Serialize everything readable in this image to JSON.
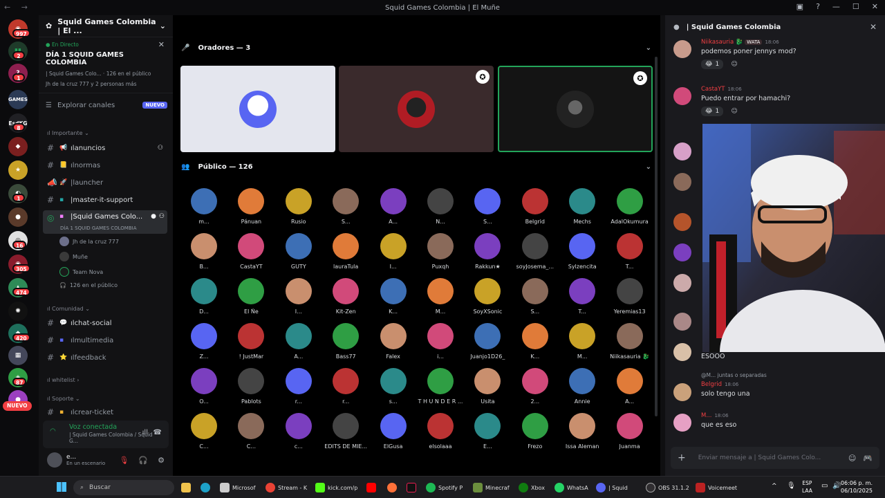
{
  "window": {
    "title": "Squid Games Colombia | El Muñe",
    "nav": "← →"
  },
  "servers": {
    "badges": [
      "997",
      "2",
      "1",
      "8",
      "1",
      "16",
      "305",
      "474",
      "420",
      "87"
    ],
    "nuevo": "NUEVO",
    "labels": [
      "GAMES",
      "EsdKG"
    ]
  },
  "sidebar": {
    "server_name": "Squid Games Colombia | El ...",
    "live": {
      "tag": "En Directo",
      "title": "DÍA 1 SQUID GAMES COLOMBIA",
      "subtitle": "| Squid Games Colo... · 126 en el público",
      "people": "Jh de la cruz 777 y 2 personas más"
    },
    "explore": "Explorar canales",
    "explore_badge": "NUEVO",
    "categories": [
      "Importante",
      "Comunidad",
      "whitelist",
      "Soporte"
    ],
    "channels": [
      {
        "name": "anuncios",
        "emoji": "📢"
      },
      {
        "name": "normas",
        "emoji": "📒"
      },
      {
        "name": "launcher",
        "emoji": "🚀"
      },
      {
        "name": "master-it-support",
        "emoji": "▪"
      },
      {
        "name": "Squid Games Colo...",
        "emoji": "▪",
        "sub": "DÍA 1 SQUID GAMES COLOMBIA"
      },
      {
        "name": "chat-social",
        "emoji": "💬"
      },
      {
        "name": "multimedia",
        "emoji": "▪"
      },
      {
        "name": "feedback",
        "emoji": "⭐"
      },
      {
        "name": "crear-ticket",
        "emoji": "▪"
      }
    ],
    "voice_members": [
      "Jh de la cruz 777",
      "Muñe",
      "Team Nova",
      "126 en el público"
    ],
    "voice_panel": {
      "title": "Voz conectada",
      "subtitle": "| Squid Games Colombia / Squid G..."
    },
    "user": {
      "name": "e...",
      "status": "En un escenario"
    }
  },
  "stage": {
    "speakers_header": "Oradores — 3",
    "audience_header": "Público — 126",
    "audience": [
      "m...",
      "Pánuan",
      "Rusio",
      "S...",
      "A...",
      "N...",
      "S...",
      "Belgrid",
      "Mechs",
      "AdalOkumura",
      "B...",
      "CastaYT",
      "GUTY",
      "lauraTula",
      "I...",
      "Puxqh",
      "Rakkun★",
      "soyJosema_...",
      "Sylzencita",
      "T...",
      "D...",
      "El Ñe",
      "I...",
      "Kit-Zen",
      "K...",
      "M...",
      "SoyXSonic",
      "S...",
      "T...",
      "Yeremias13",
      "Z...",
      "! JustMar",
      "A...",
      "Bass77",
      "Falex",
      "i...",
      "Juanjo1D26_",
      "K...",
      "M...",
      "Niikasauria 🐉",
      "O...",
      "Pablots",
      "r...",
      "r...",
      "s...",
      "T H U N D E R ...",
      "Usita",
      "2...",
      "Annie",
      "A...",
      "C...",
      "C...",
      "c...",
      "EDITS DE MIE...",
      "ElGusa",
      "elsolaaa",
      "E...",
      "Frezo",
      "Issa Aleman",
      "Juanma"
    ]
  },
  "chat": {
    "title": "| Squid Games Colombia",
    "messages": [
      {
        "name": "Niikasauria 🐉",
        "tag": "WATA",
        "time": "18:06",
        "text": "podemos poner jennys mod?",
        "react": "1"
      },
      {
        "name": "CastaYT",
        "time": "18:06",
        "text": "Puedo entrar por hamachi?",
        "react": "1"
      },
      {
        "name": "",
        "time": "",
        "text": "ESOOO"
      },
      {
        "name": "Belgrid",
        "time": "18:06",
        "reply": "@M... juntas o separadas",
        "text": "solo tengo una"
      },
      {
        "name": "M...",
        "time": "18:06",
        "text": "que es eso"
      }
    ],
    "input_placeholder": "Enviar mensaje a | Squid Games Colo..."
  },
  "taskbar": {
    "search": "Buscar",
    "apps": [
      "Microsof",
      "Stream - K",
      "kick.com/p",
      "Spotify P",
      "Minecraf",
      "Xbox",
      "WhatsA",
      "| Squid",
      "OBS 31.1.2",
      "Voicemeet"
    ],
    "lang": [
      "ESP",
      "LAA"
    ],
    "time": "06:06 p. m.",
    "date": "06/10/2025"
  },
  "colors": {
    "accent": "#5865f2",
    "online": "#23a55a",
    "danger": "#f23f43"
  }
}
